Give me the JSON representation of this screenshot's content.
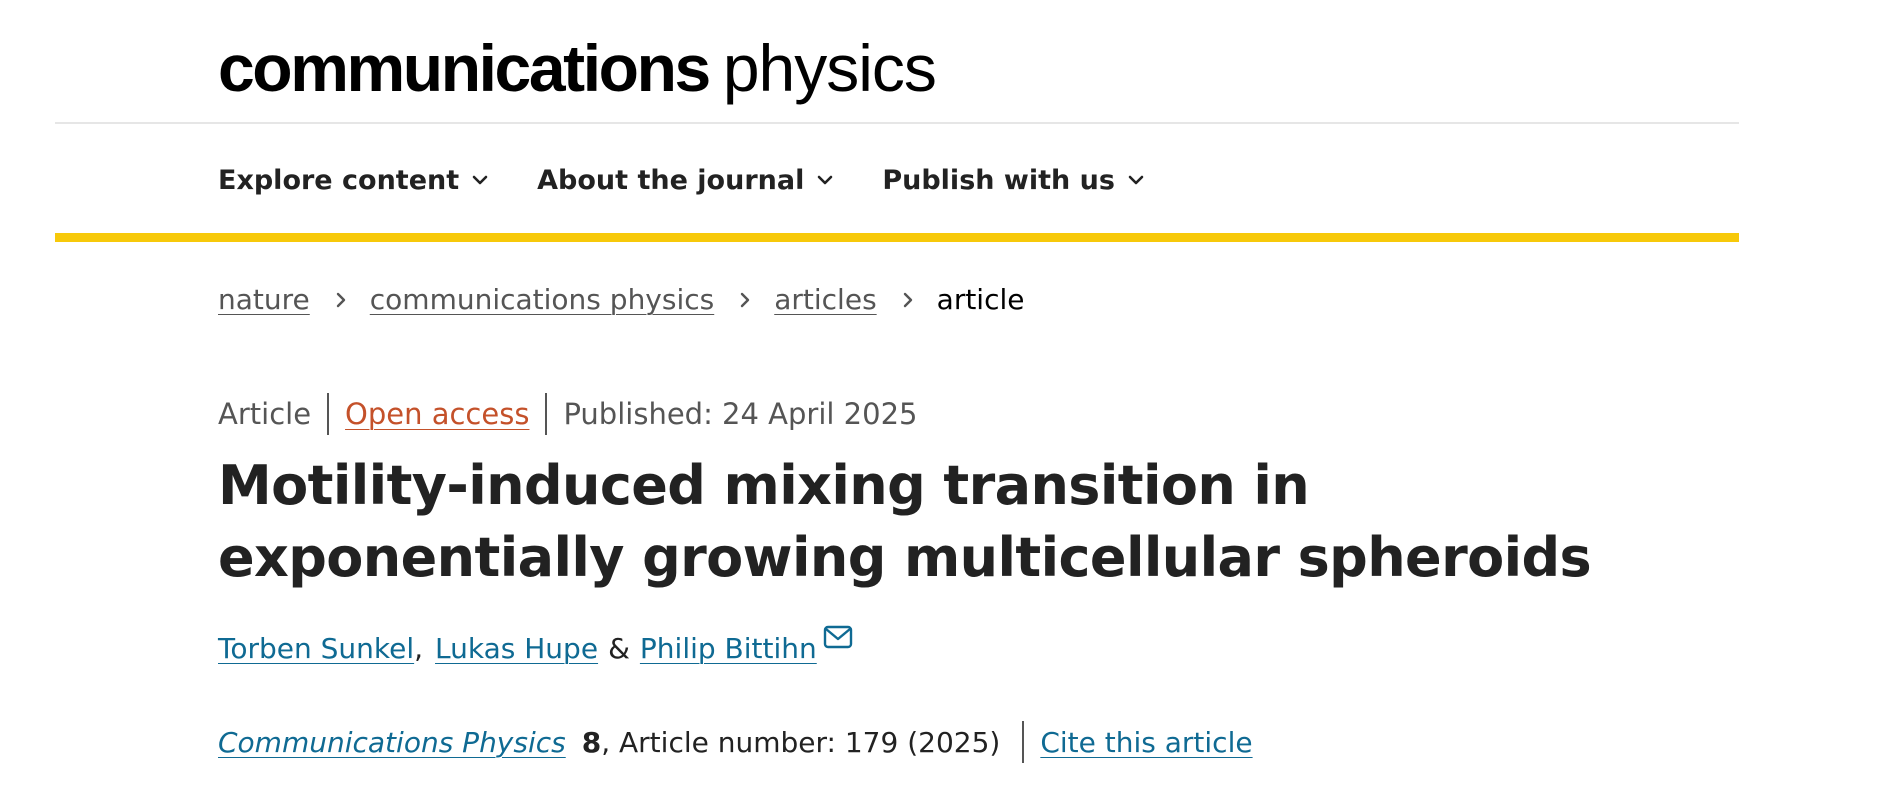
{
  "header": {
    "logo_bold": "communications",
    "logo_light": "physics"
  },
  "nav": {
    "items": [
      {
        "label": "Explore content",
        "icon": "chevron-down-icon"
      },
      {
        "label": "About the journal",
        "icon": "chevron-down-icon"
      },
      {
        "label": "Publish with us",
        "icon": "chevron-down-icon"
      }
    ]
  },
  "breadcrumb": {
    "items": [
      {
        "label": "nature"
      },
      {
        "label": "communications physics"
      },
      {
        "label": "articles"
      },
      {
        "label": "article"
      }
    ]
  },
  "article": {
    "type": "Article",
    "access": "Open access",
    "published": "Published: 24 April 2025",
    "title": "Motility-induced mixing transition in exponentially growing multicellular spheroids",
    "authors": [
      {
        "name": "Torben Sunkel"
      },
      {
        "name": "Lukas Hupe"
      },
      {
        "name": "Philip Bittihn"
      }
    ],
    "author_sep_1": ",",
    "author_sep_2": "&",
    "journal": "Communications Physics",
    "volume": "8",
    "article_number": ", Article number: 179 (2025)",
    "cite_label": "Cite this article"
  },
  "colors": {
    "accent_yellow": "#f7c90a",
    "link_blue": "#0f6a93",
    "open_access_orange": "#c4512a"
  }
}
